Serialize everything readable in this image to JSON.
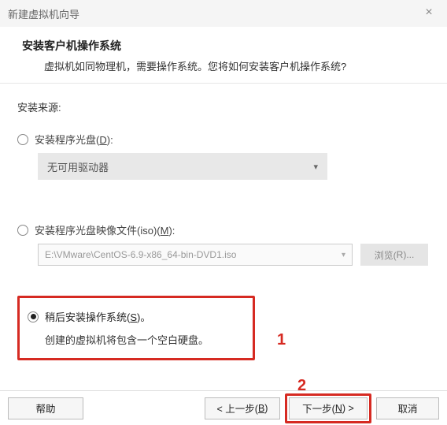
{
  "window": {
    "title": "新建虚拟机向导"
  },
  "header": {
    "title": "安装客户机操作系统",
    "subtitle": "虚拟机如同物理机，需要操作系统。您将如何安装客户机操作系统?"
  },
  "source_label": "安装来源:",
  "opt1": {
    "label_pre": "安装程序光盘(",
    "label_key": "D",
    "label_post": "):",
    "dropdown": "无可用驱动器"
  },
  "opt2": {
    "label_pre": "安装程序光盘映像文件(iso)(",
    "label_key": "M",
    "label_post": "):",
    "combo": "E:\\VMware\\CentOS-6.9-x86_64-bin-DVD1.iso",
    "browse_pre": "浏览(",
    "browse_key": "R",
    "browse_post": ")..."
  },
  "opt3": {
    "label_pre": "稍后安装操作系统(",
    "label_key": "S",
    "label_post": ")。",
    "desc": "创建的虚拟机将包含一个空白硬盘。"
  },
  "annot": {
    "one": "1",
    "two": "2"
  },
  "footer": {
    "help": "帮助",
    "back_pre": "< 上一步(",
    "back_key": "B",
    "back_post": ")",
    "next_pre": "下一步(",
    "next_key": "N",
    "next_post": ") >",
    "cancel": "取消"
  }
}
